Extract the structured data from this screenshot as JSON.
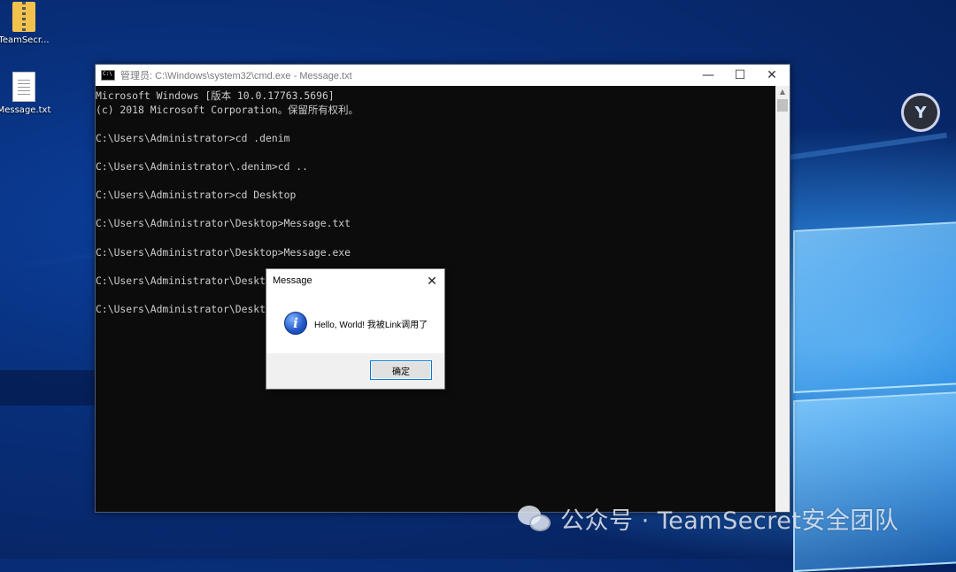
{
  "desktop": {
    "icons": [
      {
        "label": "TeamSecr...",
        "icon": "zip-folder-icon"
      },
      {
        "label": "Message.txt",
        "icon": "text-file-icon"
      }
    ],
    "floating_app_icon": "app-logo-icon"
  },
  "cmd_window": {
    "title": "管理员: C:\\Windows\\system32\\cmd.exe - Message.txt",
    "controls": {
      "minimize": "—",
      "maximize": "☐",
      "close": "✕"
    },
    "lines": [
      "Microsoft Windows [版本 10.0.17763.5696]",
      "(c) 2018 Microsoft Corporation。保留所有权利。",
      "",
      "C:\\Users\\Administrator>cd .denim",
      "",
      "C:\\Users\\Administrator\\.denim>cd ..",
      "",
      "C:\\Users\\Administrator>cd Desktop",
      "",
      "C:\\Users\\Administrator\\Desktop>Message.txt",
      "",
      "C:\\Users\\Administrator\\Desktop>Message.exe",
      "",
      "C:\\Users\\Administrator\\Desktop",
      "",
      "C:\\Users\\Administrator\\Desktop"
    ]
  },
  "dialog": {
    "title": "Message",
    "close": "✕",
    "message": "Hello, World! 我被Link调用了",
    "ok_label": "确定",
    "icon": "info-icon"
  },
  "watermark": {
    "text": "公众号 · TeamSecret安全团队",
    "icon": "wechat-icon"
  }
}
